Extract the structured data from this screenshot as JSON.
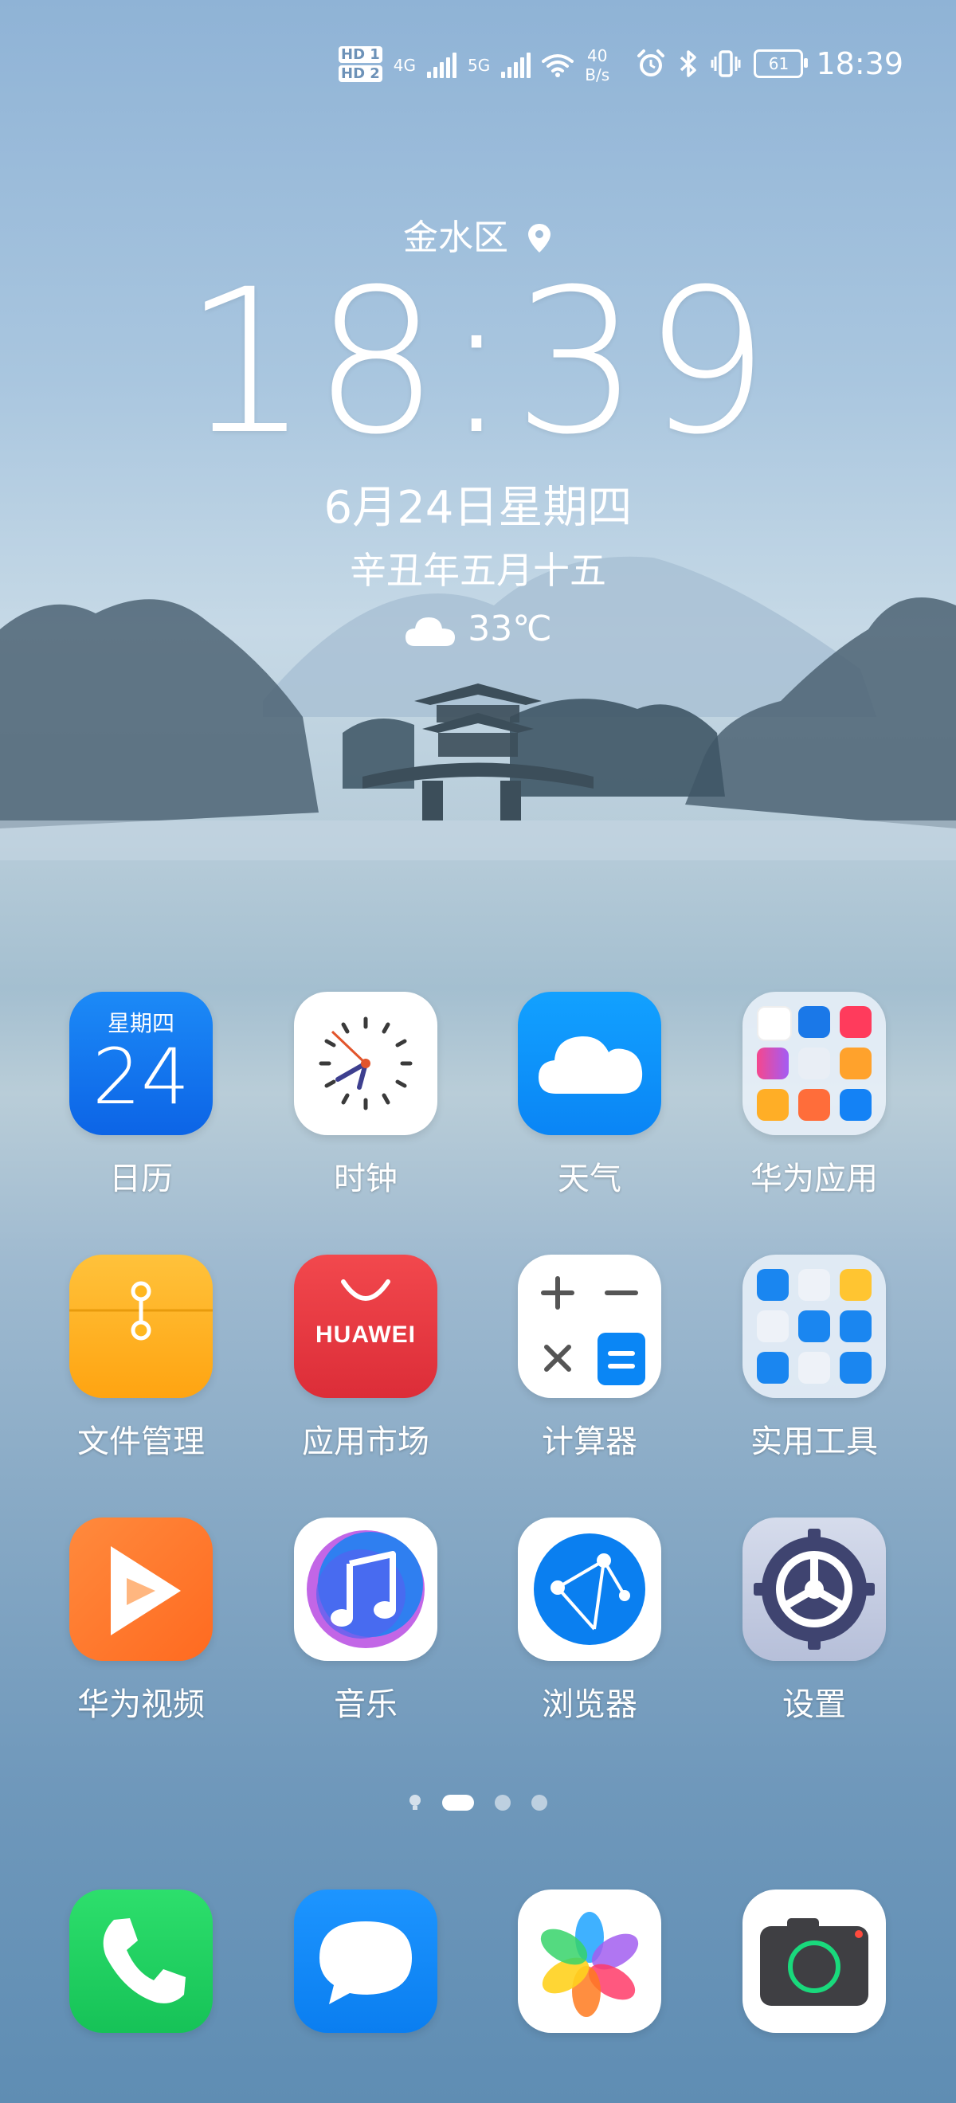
{
  "status_bar": {
    "sim1": "HD 1",
    "sim2": "HD 2",
    "net1": "4G",
    "net2": "5G",
    "speed_value": "40",
    "speed_unit": "B/s",
    "battery": "61",
    "time": "18:39"
  },
  "clock_widget": {
    "location": "金水区",
    "time": "18:39",
    "date": "6月24日星期四",
    "lunar": "辛丑年五月十五",
    "temperature": "33℃",
    "weather_icon": "cloud-icon"
  },
  "apps": [
    {
      "label": "日历",
      "icon": "calendar-icon",
      "weekday": "星期四",
      "day": "24"
    },
    {
      "label": "时钟",
      "icon": "clock-icon"
    },
    {
      "label": "天气",
      "icon": "weather-icon"
    },
    {
      "label": "华为应用",
      "icon": "folder-icon"
    },
    {
      "label": "文件管理",
      "icon": "files-icon"
    },
    {
      "label": "应用市场",
      "icon": "appgallery-icon",
      "brand": "HUAWEI"
    },
    {
      "label": "计算器",
      "icon": "calculator-icon"
    },
    {
      "label": "实用工具",
      "icon": "folder-icon"
    },
    {
      "label": "华为视频",
      "icon": "video-icon"
    },
    {
      "label": "音乐",
      "icon": "music-icon"
    },
    {
      "label": "浏览器",
      "icon": "browser-icon"
    },
    {
      "label": "设置",
      "icon": "settings-icon"
    }
  ],
  "page_indicator": {
    "pages": 3,
    "current": 1
  },
  "dock": [
    {
      "icon": "phone-icon"
    },
    {
      "icon": "messages-icon"
    },
    {
      "icon": "gallery-icon"
    },
    {
      "icon": "camera-icon"
    }
  ],
  "colors": {
    "calendar": "#1677f2",
    "weather": "#0a92ff",
    "files": "#ffb11e",
    "appgallery": "#e8393f",
    "video": "#ff7a2d",
    "phone": "#1fd160",
    "messages": "#1a8cff"
  }
}
